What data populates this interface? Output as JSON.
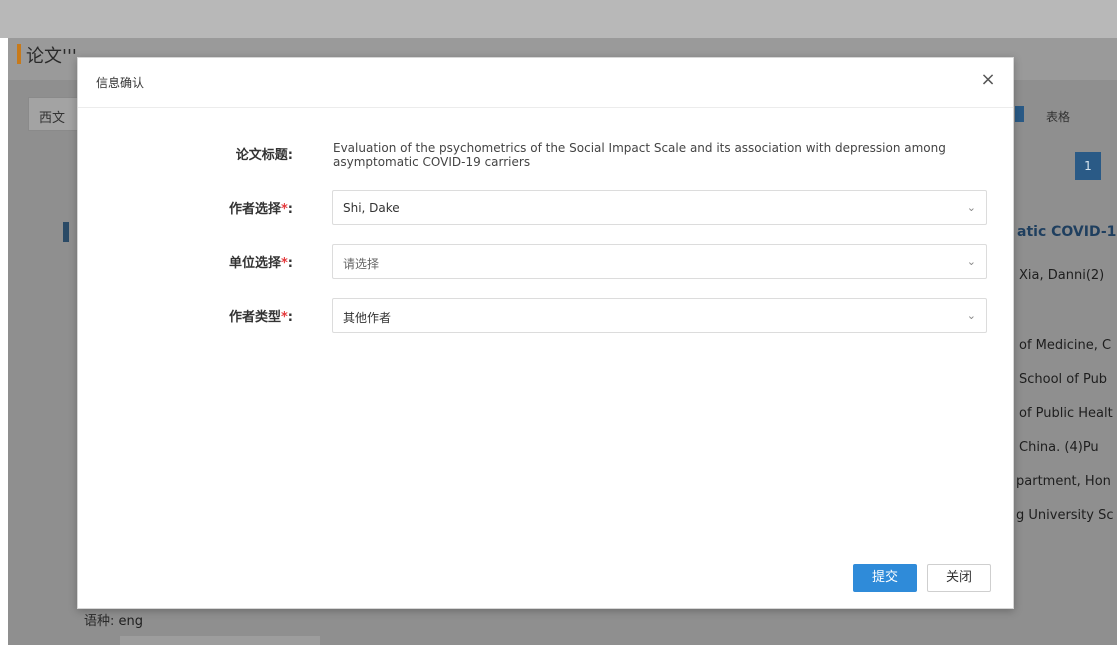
{
  "background": {
    "page_title": "论文'''",
    "tab_label": "西文",
    "right_toggle_label": "表格",
    "page_number": "1",
    "snippets": [
      "atic COVID-1",
      "Xia, Danni(2)",
      "of Medicine, C",
      "School of Pub",
      "of Public Healt",
      "China.  (4)Pu",
      "partment, Hon",
      "g University Sc"
    ],
    "language_label": "语种:",
    "language_value": "eng"
  },
  "modal": {
    "title": "信息确认",
    "close_glyph": "×",
    "paper_title_label": "论文标题:",
    "paper_title_value": "Evaluation of the psychometrics of the Social Impact Scale and its association with depression among asymptomatic COVID-19 carriers",
    "required_mark": "*",
    "colon": ":",
    "author_select_label": "作者选择",
    "author_select_value": "Shi, Dake",
    "unit_select_label": "单位选择",
    "unit_select_placeholder": "请选择",
    "author_type_label": "作者类型",
    "author_type_value": "其他作者",
    "caret_glyph": "⌄",
    "submit_label": "提交",
    "close_label": "关闭"
  },
  "colors": {
    "accent_blue": "#2f8bd9",
    "required_red": "#e4393c",
    "title_accent": "#c87a1a"
  }
}
